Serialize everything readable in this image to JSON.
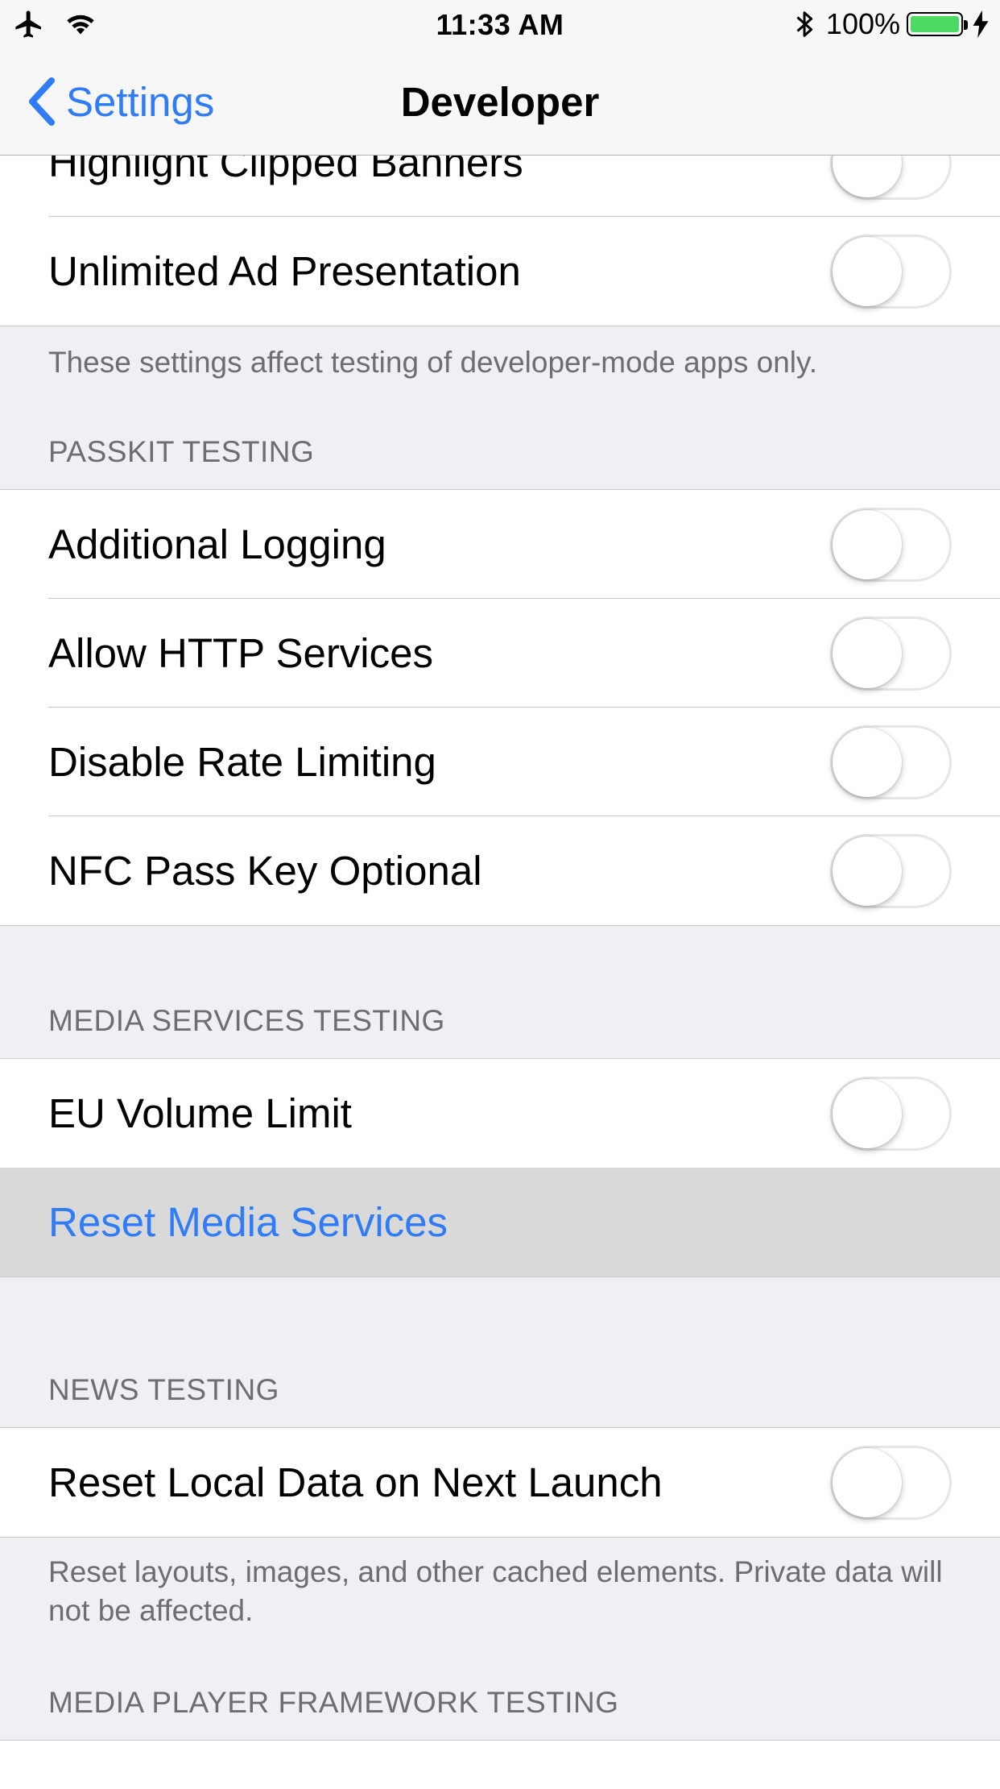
{
  "status_bar": {
    "time": "11:33 AM",
    "battery_percent": "100%",
    "battery_level": 1.0,
    "icons": [
      "airplane-icon",
      "wifi-icon",
      "bluetooth-icon",
      "battery-icon",
      "charging-icon"
    ]
  },
  "nav": {
    "back_label": "Settings",
    "title": "Developer",
    "accent_color": "#2f7cf6"
  },
  "group_ads": {
    "rows": [
      {
        "label": "Highlight Clipped Banners",
        "on": false
      },
      {
        "label": "Unlimited Ad Presentation",
        "on": false
      }
    ],
    "footer": "These settings affect testing of developer-mode apps only."
  },
  "group_passkit": {
    "header": "PASSKIT TESTING",
    "rows": [
      {
        "label": "Additional Logging",
        "on": false
      },
      {
        "label": "Allow HTTP Services",
        "on": false
      },
      {
        "label": "Disable Rate Limiting",
        "on": false
      },
      {
        "label": "NFC Pass Key Optional",
        "on": false
      }
    ]
  },
  "group_media": {
    "header": "MEDIA SERVICES TESTING",
    "toggle_row": {
      "label": "EU Volume Limit",
      "on": false
    },
    "action_row": {
      "label": "Reset Media Services"
    }
  },
  "group_news": {
    "header": "NEWS TESTING",
    "toggle_row": {
      "label": "Reset Local Data on Next Launch",
      "on": false
    },
    "footer": "Reset layouts, images, and other cached elements. Private data will not be affected."
  },
  "group_player": {
    "header": "MEDIA PLAYER FRAMEWORK TESTING"
  }
}
